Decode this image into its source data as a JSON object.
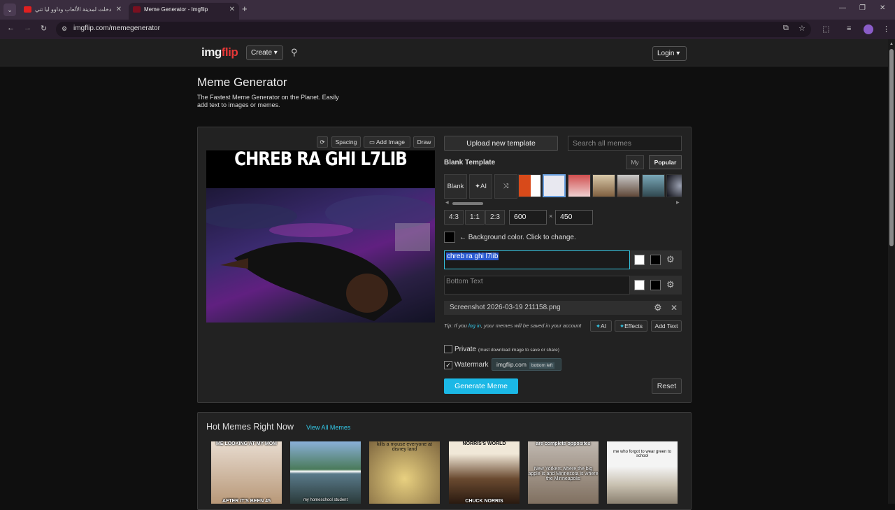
{
  "browser": {
    "tabs": [
      {
        "title": "دخلت لمدينة الألعاب وداوو ليا تني...",
        "close": "✕"
      },
      {
        "title": "Meme Generator - Imgflip",
        "close": "✕"
      }
    ],
    "new_tab": "+",
    "url": "imgflip.com/memegenerator"
  },
  "header": {
    "logo_img": "img",
    "logo_flip": "flip",
    "create_label": "Create ▾",
    "login_label": "Login ▾"
  },
  "intro": {
    "title": "Meme Generator",
    "subtitle": "The Fastest Meme Generator on the Planet. Easily add text to images or memes."
  },
  "editor": {
    "toolbar": {
      "spacing": "Spacing",
      "add_image": "Add Image",
      "draw": "Draw"
    },
    "meme_caption": "CHREB RA GHI L7LIB",
    "upload_label": "Upload new template",
    "search_placeholder": "Search all memes",
    "blank_template": "Blank Template",
    "tab_my": "My",
    "tab_popular": "Popular",
    "strip_blank": "Blank",
    "strip_ai": "AI",
    "ratios": [
      "4:3",
      "1:1",
      "2:3"
    ],
    "width": "600",
    "height": "450",
    "dim_sep": "×",
    "bg_label": "← Background color. Click to change.",
    "top_text": "chreb ra ghi l7lib",
    "bottom_placeholder": "Bottom Text",
    "file_name": "Screenshot 2026-03-19 211158.png",
    "tip_pre": "Tip: If you ",
    "tip_link": "log in",
    "tip_post": ", your memes will be saved in your account",
    "ai_btn": "AI",
    "effects_btn": "Effects",
    "add_text_btn": "Add Text",
    "private_label": "Private",
    "private_note": "(must download image to save or share)",
    "watermark_label": "Watermark",
    "watermark_site": "imgflip.com",
    "watermark_pos": "bottom left",
    "generate_label": "Generate Meme",
    "reset_label": "Reset"
  },
  "hot": {
    "title": "Hot Memes Right Now",
    "link": "View All Memes",
    "items": [
      {
        "top": "ME LOOKING AT MY MOM",
        "bottom": "AFTER IT'S BEEN 45"
      },
      {
        "top": "",
        "bottom": "my homeschool student"
      },
      {
        "top": "kills a mouse everyone at disney land",
        "bottom": ""
      },
      {
        "top": "NORRIS'S WORLD",
        "bottom": "CHUCK NORRIS"
      },
      {
        "top": "are complete opposites",
        "bottom": "New Yorkers where the big apple is and Minnesota is where the Minneapolis"
      },
      {
        "top": "me who forgot to wear green to school",
        "bottom": ""
      }
    ]
  },
  "colors": {
    "accent": "#1bb8e6",
    "active_border": "#35c5e0",
    "logo_red": "#e83838"
  }
}
